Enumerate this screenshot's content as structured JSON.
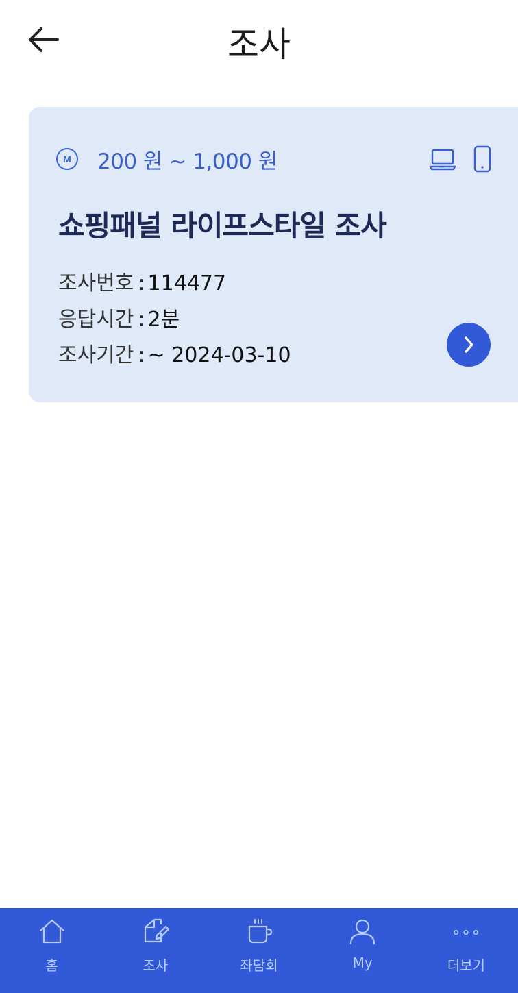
{
  "header": {
    "title": "조사",
    "back_icon": "arrow-left-icon"
  },
  "survey_card": {
    "reward_badge": "M",
    "reward_text": "200 원 ~ 1,000 원",
    "devices": [
      "laptop-icon",
      "phone-icon"
    ],
    "title": "쇼핑패널 라이프스타일 조사",
    "rows": [
      {
        "label": "조사번호",
        "sep": ":",
        "value": "114477"
      },
      {
        "label": "응답시간",
        "sep": ":",
        "value": "2분"
      },
      {
        "label": "조사기간",
        "sep": ":",
        "value": "~ 2024-03-10"
      }
    ],
    "action_icon": "chevron-right-icon"
  },
  "tabbar": {
    "items": [
      {
        "label": "홈",
        "icon": "home-icon"
      },
      {
        "label": "조사",
        "icon": "survey-edit-icon"
      },
      {
        "label": "좌담회",
        "icon": "coffee-cup-icon"
      },
      {
        "label": "My",
        "icon": "user-icon"
      },
      {
        "label": "더보기",
        "icon": "more-dots-icon"
      }
    ]
  },
  "colors": {
    "accent": "#3159d8",
    "card_bg": "#dfe9f8",
    "reward_text": "#3a5fc9",
    "tab_label": "#b8cbff"
  }
}
